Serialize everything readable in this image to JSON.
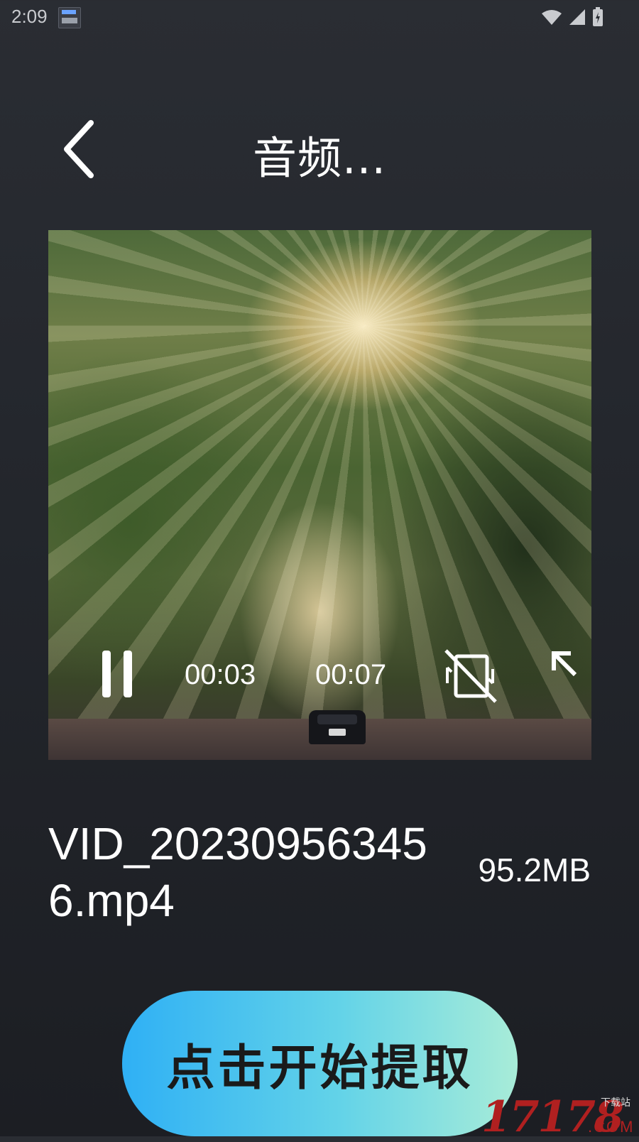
{
  "status_bar": {
    "time": "2:09"
  },
  "header": {
    "title": "音频..."
  },
  "video": {
    "current_time": "00:03",
    "total_time": "00:07",
    "scene": "forest road with sunlight and a car"
  },
  "file": {
    "name": "VID_202309563456.mp4",
    "size": "95.2MB"
  },
  "actions": {
    "extract_label": "点击开始提取"
  },
  "watermark": {
    "number": "17178",
    "sub": "下载站",
    "domain": ".COM"
  },
  "colors": {
    "background": "#23262c",
    "button_gradient_start": "#2fb0f5",
    "button_gradient_end": "#a8ecd8"
  }
}
